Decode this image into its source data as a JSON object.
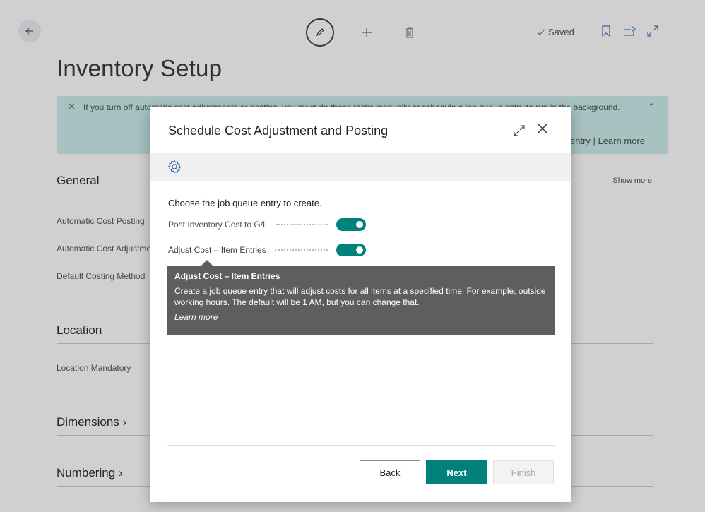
{
  "page": {
    "title": "Inventory Setup",
    "saved_label": "Saved",
    "banner": {
      "text": "If you turn off automatic cost adjustments or posting, you must do those tasks manually or schedule a job queue entry to run in the background.",
      "links": "Schedule a job queue entry | Learn more"
    },
    "sections": {
      "general": "General",
      "show_more": "Show more",
      "location": "Location",
      "dimensions": "Dimensions",
      "numbering": "Numbering"
    },
    "fields": {
      "automatic_cost_posting": "Automatic Cost Posting",
      "automatic_cost_adjustment": "Automatic Cost Adjustment",
      "default_costing_method": "Default Costing Method",
      "location_mandatory": "Location Mandatory"
    }
  },
  "dialog": {
    "title": "Schedule Cost Adjustment and Posting",
    "instruction": "Choose the job queue entry to create.",
    "options": [
      {
        "label": "Post Inventory Cost to G/L",
        "enabled": true
      },
      {
        "label": "Adjust Cost – Item Entries",
        "enabled": true
      }
    ],
    "tooltip": {
      "title": "Adjust Cost – Item Entries",
      "body": "Create a job queue entry that will adjust costs for all items at a specified time. For example, outside working hours. The default will be 1 AM, but you can change that.",
      "link": "Learn more"
    },
    "buttons": {
      "back": "Back",
      "next": "Next",
      "finish": "Finish"
    }
  },
  "colors": {
    "accent": "#00827a",
    "banner": "#ccecec",
    "tooltip": "#5e5e5e"
  }
}
